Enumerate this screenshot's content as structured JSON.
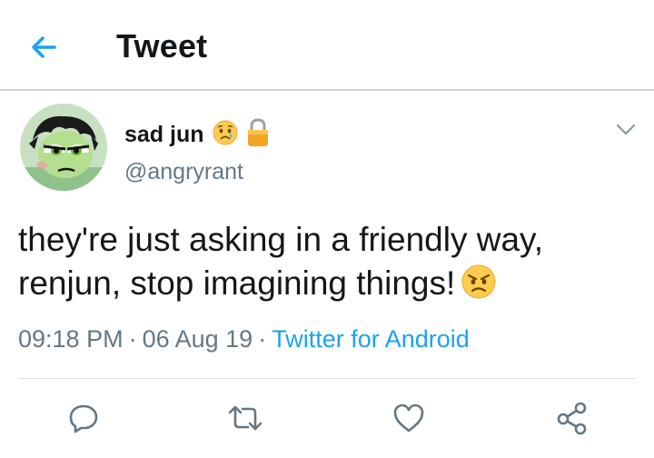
{
  "header": {
    "title": "Tweet",
    "back_icon": "arrow-left-icon"
  },
  "author": {
    "display_name": "sad jun",
    "handle": "@angryrant",
    "name_emojis": [
      "sad-tear-face-emoji",
      "lock-emoji"
    ],
    "avatar_icon": "avatar-image"
  },
  "tweet": {
    "line1": "they're just asking in a friendly way,",
    "line2": "renjun, stop imagining things!",
    "trailing_emoji": "angry-face-emoji"
  },
  "meta": {
    "time": "09:18 PM",
    "separator": "·",
    "date": "06 Aug 19",
    "source": "Twitter for Android"
  },
  "actions": [
    {
      "icon": "reply-icon"
    },
    {
      "icon": "retweet-icon"
    },
    {
      "icon": "like-icon"
    },
    {
      "icon": "share-icon"
    }
  ],
  "colors": {
    "accent": "#1da1f2",
    "text": "#14171a",
    "secondary": "#657786",
    "border": "#cfd5da"
  }
}
